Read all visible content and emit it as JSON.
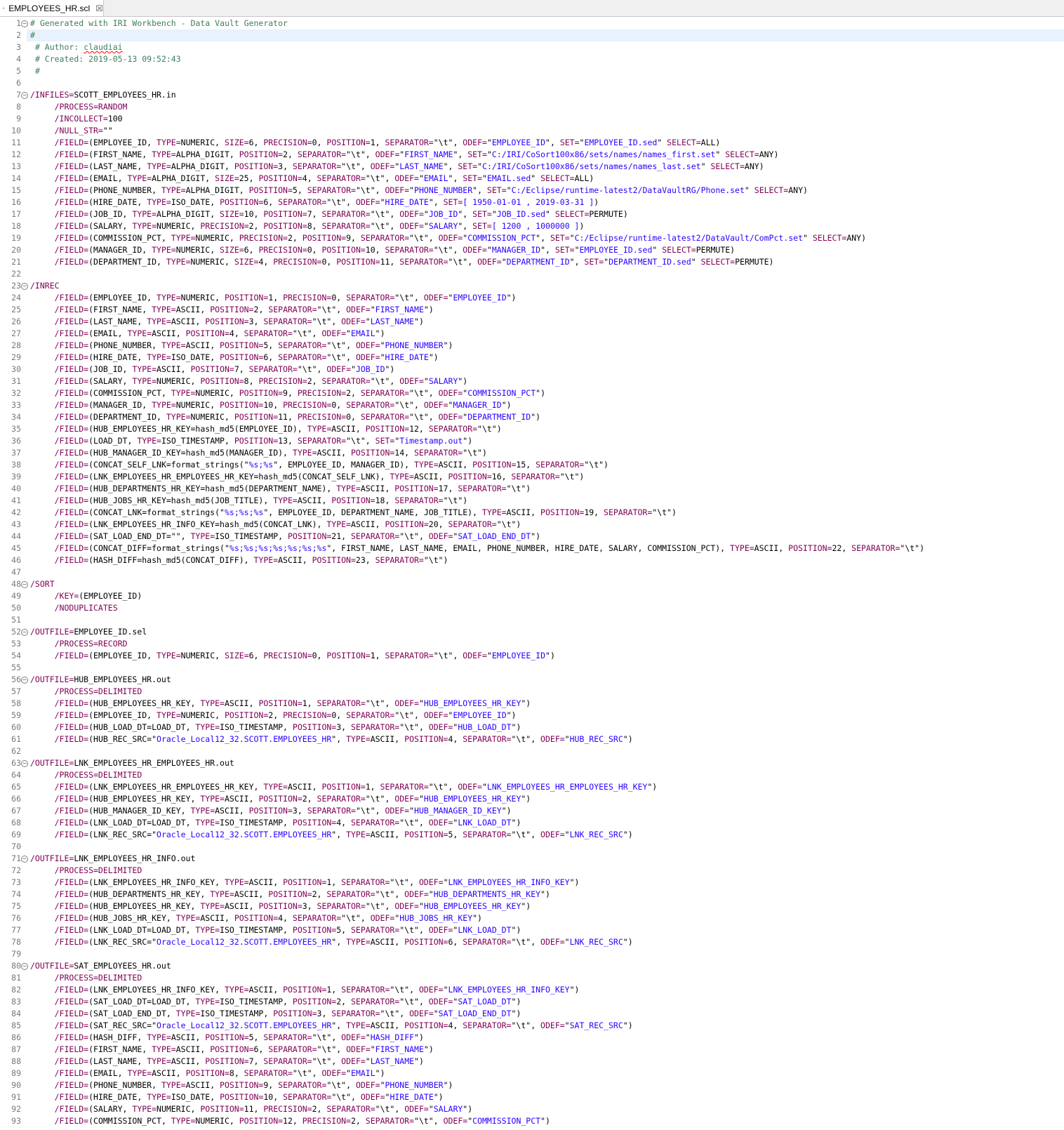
{
  "tab": {
    "file_name": "EMPLOYEES_HR.scl",
    "close_glyph": "☒",
    "icon": "scl-file-icon"
  },
  "colors": {
    "comment": "#3f7f5f",
    "keyword": "#7f0055",
    "string": "#2a00ff",
    "plain": "#000000",
    "line_number": "#787878",
    "current_line": "#e8f2fe"
  },
  "editor": {
    "current_line": 2,
    "lines": [
      {
        "n": "1",
        "f": true,
        "s": "<# Generated with IRI Workbench - Data Vault Generator>"
      },
      {
        "n": "2",
        "s": "<#>"
      },
      {
        "n": "3",
        "s": " <# Author: ><~claudiai>"
      },
      {
        "n": "4",
        "s": " <# Created: 2019-05-13 09:52:43>"
      },
      {
        "n": "5",
        "s": " <#>"
      },
      {
        "n": "6",
        "s": ""
      },
      {
        "n": "7",
        "f": true,
        "s": "[/INFILES=]SCOTT_EMPLOYEES_HR.in"
      },
      {
        "n": "8",
        "s": "     [/PROCESS=RANDOM]"
      },
      {
        "n": "9",
        "s": "     [/INCOLLECT=]100"
      },
      {
        "n": "10",
        "s": "     [/NULL_STR=]\"\""
      },
      {
        "n": "11",
        "s": "     [/FIELD=](EMPLOYEE_ID, [TYPE=]NUMERIC, [SIZE=]6, [PRECISION=]0, [POSITION=]1, [SEPARATOR=]\"\\t\", [ODEF=]\"{EMPLOYEE_ID}\", [SET=]\"{EMPLOYEE_ID.sed}\" [SELECT=]ALL)"
      },
      {
        "n": "12",
        "s": "     [/FIELD=](FIRST_NAME, [TYPE=]ALPHA_DIGIT, [POSITION=]2, [SEPARATOR=]\"\\t\", [ODEF=]\"{FIRST_NAME}\", [SET=]\"{C:/IRI/CoSort100x86/sets/names/names_first.set}\" [SELECT=]ANY)"
      },
      {
        "n": "13",
        "s": "     [/FIELD=](LAST_NAME, [TYPE=]ALPHA_DIGIT, [POSITION=]3, [SEPARATOR=]\"\\t\", [ODEF=]\"{LAST_NAME}\", [SET=]\"{C:/IRI/CoSort100x86/sets/names/names_last.set}\" [SELECT=]ANY)"
      },
      {
        "n": "14",
        "s": "     [/FIELD=](EMAIL, [TYPE=]ALPHA_DIGIT, [SIZE=]25, [POSITION=]4, [SEPARATOR=]\"\\t\", [ODEF=]\"{EMAIL}\", [SET=]\"{EMAIL.sed}\" [SELECT=]ALL)"
      },
      {
        "n": "15",
        "s": "     [/FIELD=](PHONE_NUMBER, [TYPE=]ALPHA_DIGIT, [POSITION=]5, [SEPARATOR=]\"\\t\", [ODEF=]\"{PHONE_NUMBER}\", [SET=]\"{C:/Eclipse/runtime-latest2/DataVaultRG/Phone.set}\" [SELECT=]ANY)"
      },
      {
        "n": "16",
        "s": "     [/FIELD=](HIRE_DATE, [TYPE=]ISO_DATE, [POSITION=]6, [SEPARATOR=]\"\\t\", [ODEF=]\"{HIRE_DATE}\", [SET=]{[ 1950-01-01 , 2019-03-31 ]})"
      },
      {
        "n": "17",
        "s": "     [/FIELD=](JOB_ID, [TYPE=]ALPHA_DIGIT, [SIZE=]10, [POSITION=]7, [SEPARATOR=]\"\\t\", [ODEF=]\"{JOB_ID}\", [SET=]\"{JOB_ID.sed}\" [SELECT=]PERMUTE)"
      },
      {
        "n": "18",
        "s": "     [/FIELD=](SALARY, [TYPE=]NUMERIC, [PRECISION=]2, [POSITION=]8, [SEPARATOR=]\"\\t\", [ODEF=]\"{SALARY}\", [SET=]{[ 1200 , 1000000 ]})"
      },
      {
        "n": "19",
        "s": "     [/FIELD=](COMMISSION_PCT, [TYPE=]NUMERIC, [PRECISION=]2, [POSITION=]9, [SEPARATOR=]\"\\t\", [ODEF=]\"{COMMISSION_PCT}\", [SET=]\"{C:/Eclipse/runtime-latest2/DataVault/ComPct.set}\" [SELECT=]ANY)"
      },
      {
        "n": "20",
        "s": "     [/FIELD=](MANAGER_ID, [TYPE=]NUMERIC, [SIZE=]6, [PRECISION=]0, [POSITION=]10, [SEPARATOR=]\"\\t\", [ODEF=]\"{MANAGER_ID}\", [SET=]\"{EMPLOYEE_ID.sed}\" [SELECT=]PERMUTE)"
      },
      {
        "n": "21",
        "s": "     [/FIELD=](DEPARTMENT_ID, [TYPE=]NUMERIC, [SIZE=]4, [PRECISION=]0, [POSITION=]11, [SEPARATOR=]\"\\t\", [ODEF=]\"{DEPARTMENT_ID}\", [SET=]\"{DEPARTMENT_ID.sed}\" [SELECT=]PERMUTE)"
      },
      {
        "n": "22",
        "s": ""
      },
      {
        "n": "23",
        "f": true,
        "s": "[/INREC]"
      },
      {
        "n": "24",
        "s": "     [/FIELD=](EMPLOYEE_ID, [TYPE=]NUMERIC, [POSITION=]1, [PRECISION=]0, [SEPARATOR=]\"\\t\", [ODEF=]\"{EMPLOYEE_ID}\")"
      },
      {
        "n": "25",
        "s": "     [/FIELD=](FIRST_NAME, [TYPE=]ASCII, [POSITION=]2, [SEPARATOR=]\"\\t\", [ODEF=]\"{FIRST_NAME}\")"
      },
      {
        "n": "26",
        "s": "     [/FIELD=](LAST_NAME, [TYPE=]ASCII, [POSITION=]3, [SEPARATOR=]\"\\t\", [ODEF=]\"{LAST_NAME}\")"
      },
      {
        "n": "27",
        "s": "     [/FIELD=](EMAIL, [TYPE=]ASCII, [POSITION=]4, [SEPARATOR=]\"\\t\", [ODEF=]\"{EMAIL}\")"
      },
      {
        "n": "28",
        "s": "     [/FIELD=](PHONE_NUMBER, [TYPE=]ASCII, [POSITION=]5, [SEPARATOR=]\"\\t\", [ODEF=]\"{PHONE_NUMBER}\")"
      },
      {
        "n": "29",
        "s": "     [/FIELD=](HIRE_DATE, [TYPE=]ISO_DATE, [POSITION=]6, [SEPARATOR=]\"\\t\", [ODEF=]\"{HIRE_DATE}\")"
      },
      {
        "n": "30",
        "s": "     [/FIELD=](JOB_ID, [TYPE=]ASCII, [POSITION=]7, [SEPARATOR=]\"\\t\", [ODEF=]\"{JOB_ID}\")"
      },
      {
        "n": "31",
        "s": "     [/FIELD=](SALARY, [TYPE=]NUMERIC, [POSITION=]8, [PRECISION=]2, [SEPARATOR=]\"\\t\", [ODEF=]\"{SALARY}\")"
      },
      {
        "n": "32",
        "s": "     [/FIELD=](COMMISSION_PCT, [TYPE=]NUMERIC, [POSITION=]9, [PRECISION=]2, [SEPARATOR=]\"\\t\", [ODEF=]\"{COMMISSION_PCT}\")"
      },
      {
        "n": "33",
        "s": "     [/FIELD=](MANAGER_ID, [TYPE=]NUMERIC, [POSITION=]10, [PRECISION=]0, [SEPARATOR=]\"\\t\", [ODEF=]\"{MANAGER_ID}\")"
      },
      {
        "n": "34",
        "s": "     [/FIELD=](DEPARTMENT_ID, [TYPE=]NUMERIC, [POSITION=]11, [PRECISION=]0, [SEPARATOR=]\"\\t\", [ODEF=]\"{DEPARTMENT_ID}\")"
      },
      {
        "n": "35",
        "s": "     [/FIELD=](HUB_EMPLOYEES_HR_KEY=hash_md5(EMPLOYEE_ID), [TYPE=]ASCII, [POSITION=]12, [SEPARATOR=]\"\\t\")"
      },
      {
        "n": "36",
        "s": "     [/FIELD=](LOAD_DT, [TYPE=]ISO_TIMESTAMP, [POSITION=]13, [SEPARATOR=]\"\\t\", [SET=]\"{Timestamp.out}\")"
      },
      {
        "n": "37",
        "s": "     [/FIELD=](HUB_MANAGER_ID_KEY=hash_md5(MANAGER_ID), [TYPE=]ASCII, [POSITION=]14, [SEPARATOR=]\"\\t\")"
      },
      {
        "n": "38",
        "s": "     [/FIELD=](CONCAT_SELF_LNK=format_strings(\"{%s;%s}\", EMPLOYEE_ID, MANAGER_ID), [TYPE=]ASCII, [POSITION=]15, [SEPARATOR=]\"\\t\")"
      },
      {
        "n": "39",
        "s": "     [/FIELD=](LNK_EMPLOYEES_HR_EMPLOYEES_HR_KEY=hash_md5(CONCAT_SELF_LNK), [TYPE=]ASCII, [POSITION=]16, [SEPARATOR=]\"\\t\")"
      },
      {
        "n": "40",
        "s": "     [/FIELD=](HUB_DEPARTMENTS_HR_KEY=hash_md5(DEPARTMENT_NAME), [TYPE=]ASCII, [POSITION=]17, [SEPARATOR=]\"\\t\")"
      },
      {
        "n": "41",
        "s": "     [/FIELD=](HUB_JOBS_HR_KEY=hash_md5(JOB_TITLE), [TYPE=]ASCII, [POSITION=]18, [SEPARATOR=]\"\\t\")"
      },
      {
        "n": "42",
        "s": "     [/FIELD=](CONCAT_LNK=format_strings(\"{%s;%s;%s}\", EMPLOYEE_ID, DEPARTMENT_NAME, JOB_TITLE), [TYPE=]ASCII, [POSITION=]19, [SEPARATOR=]\"\\t\")"
      },
      {
        "n": "43",
        "s": "     [/FIELD=](LNK_EMPLOYEES_HR_INFO_KEY=hash_md5(CONCAT_LNK), [TYPE=]ASCII, [POSITION=]20, [SEPARATOR=]\"\\t\")"
      },
      {
        "n": "44",
        "s": "     [/FIELD=](SAT_LOAD_END_DT=\"\", [TYPE=]ISO_TIMESTAMP, [POSITION=]21, [SEPARATOR=]\"\\t\", [ODEF=]\"{SAT_LOAD_END_DT}\")"
      },
      {
        "n": "45",
        "s": "     [/FIELD=](CONCAT_DIFF=format_strings(\"{%s;%s;%s;%s;%s;%s;%s}\", FIRST_NAME, LAST_NAME, EMAIL, PHONE_NUMBER, HIRE_DATE, SALARY, COMMISSION_PCT), [TYPE=]ASCII, [POSITION=]22, [SEPARATOR=]\"\\t\")"
      },
      {
        "n": "46",
        "s": "     [/FIELD=](HASH_DIFF=hash_md5(CONCAT_DIFF), [TYPE=]ASCII, [POSITION=]23, [SEPARATOR=]\"\\t\")"
      },
      {
        "n": "47",
        "s": ""
      },
      {
        "n": "48",
        "f": true,
        "s": "[/SORT]"
      },
      {
        "n": "49",
        "s": "     [/KEY=](EMPLOYEE_ID)"
      },
      {
        "n": "50",
        "s": "     [/NODUPLICATES]"
      },
      {
        "n": "51",
        "s": ""
      },
      {
        "n": "52",
        "f": true,
        "s": "[/OUTFILE=]EMPLOYEE_ID.sel"
      },
      {
        "n": "53",
        "s": "     [/PROCESS=RECORD]"
      },
      {
        "n": "54",
        "s": "     [/FIELD=](EMPLOYEE_ID, [TYPE=]NUMERIC, [SIZE=]6, [PRECISION=]0, [POSITION=]1, [SEPARATOR=]\"\\t\", [ODEF=]\"{EMPLOYEE_ID}\")"
      },
      {
        "n": "55",
        "s": ""
      },
      {
        "n": "56",
        "f": true,
        "s": "[/OUTFILE=]HUB_EMPLOYEES_HR.out"
      },
      {
        "n": "57",
        "s": "     [/PROCESS=DELIMITED]"
      },
      {
        "n": "58",
        "s": "     [/FIELD=](HUB_EMPLOYEES_HR_KEY, [TYPE=]ASCII, [POSITION=]1, [SEPARATOR=]\"\\t\", [ODEF=]\"{HUB_EMPLOYEES_HR_KEY}\")"
      },
      {
        "n": "59",
        "s": "     [/FIELD=](EMPLOYEE_ID, [TYPE=]NUMERIC, [POSITION=]2, [PRECISION=]0, [SEPARATOR=]\"\\t\", [ODEF=]\"{EMPLOYEE_ID}\")"
      },
      {
        "n": "60",
        "s": "     [/FIELD=](HUB_LOAD_DT=LOAD_DT, [TYPE=]ISO_TIMESTAMP, [POSITION=]3, [SEPARATOR=]\"\\t\", [ODEF=]\"{HUB_LOAD_DT}\")"
      },
      {
        "n": "61",
        "s": "     [/FIELD=](HUB_REC_SRC=\"{Oracle_Local12_32.SCOTT.EMPLOYEES_HR}\", [TYPE=]ASCII, [POSITION=]4, [SEPARATOR=]\"\\t\", [ODEF=]\"{HUB_REC_SRC}\")"
      },
      {
        "n": "62",
        "s": ""
      },
      {
        "n": "63",
        "f": true,
        "s": "[/OUTFILE=]LNK_EMPLOYEES_HR_EMPLOYEES_HR.out"
      },
      {
        "n": "64",
        "s": "     [/PROCESS=DELIMITED]"
      },
      {
        "n": "65",
        "s": "     [/FIELD=](LNK_EMPLOYEES_HR_EMPLOYEES_HR_KEY, [TYPE=]ASCII, [POSITION=]1, [SEPARATOR=]\"\\t\", [ODEF=]\"{LNK_EMPLOYEES_HR_EMPLOYEES_HR_KEY}\")"
      },
      {
        "n": "66",
        "s": "     [/FIELD=](HUB_EMPLOYEES_HR_KEY, [TYPE=]ASCII, [POSITION=]2, [SEPARATOR=]\"\\t\", [ODEF=]\"{HUB_EMPLOYEES_HR_KEY}\")"
      },
      {
        "n": "67",
        "s": "     [/FIELD=](HUB_MANAGER_ID_KEY, [TYPE=]ASCII, [POSITION=]3, [SEPARATOR=]\"\\t\", [ODEF=]\"{HUB_MANAGER_ID_KEY}\")"
      },
      {
        "n": "68",
        "s": "     [/FIELD=](LNK_LOAD_DT=LOAD_DT, [TYPE=]ISO_TIMESTAMP, [POSITION=]4, [SEPARATOR=]\"\\t\", [ODEF=]\"{LNK_LOAD_DT}\")"
      },
      {
        "n": "69",
        "s": "     [/FIELD=](LNK_REC_SRC=\"{Oracle_Local12_32.SCOTT.EMPLOYEES_HR}\", [TYPE=]ASCII, [POSITION=]5, [SEPARATOR=]\"\\t\", [ODEF=]\"{LNK_REC_SRC}\")"
      },
      {
        "n": "70",
        "s": ""
      },
      {
        "n": "71",
        "f": true,
        "s": "[/OUTFILE=]LNK_EMPLOYEES_HR_INFO.out"
      },
      {
        "n": "72",
        "s": "     [/PROCESS=DELIMITED]"
      },
      {
        "n": "73",
        "s": "     [/FIELD=](LNK_EMPLOYEES_HR_INFO_KEY, [TYPE=]ASCII, [POSITION=]1, [SEPARATOR=]\"\\t\", [ODEF=]\"{LNK_EMPLOYEES_HR_INFO_KEY}\")"
      },
      {
        "n": "74",
        "s": "     [/FIELD=](HUB_DEPARTMENTS_HR_KEY, [TYPE=]ASCII, [POSITION=]2, [SEPARATOR=]\"\\t\", [ODEF=]\"{HUB_DEPARTMENTS_HR_KEY}\")"
      },
      {
        "n": "75",
        "s": "     [/FIELD=](HUB_EMPLOYEES_HR_KEY, [TYPE=]ASCII, [POSITION=]3, [SEPARATOR=]\"\\t\", [ODEF=]\"{HUB_EMPLOYEES_HR_KEY}\")"
      },
      {
        "n": "76",
        "s": "     [/FIELD=](HUB_JOBS_HR_KEY, [TYPE=]ASCII, [POSITION=]4, [SEPARATOR=]\"\\t\", [ODEF=]\"{HUB_JOBS_HR_KEY}\")"
      },
      {
        "n": "77",
        "s": "     [/FIELD=](LNK_LOAD_DT=LOAD_DT, [TYPE=]ISO_TIMESTAMP, [POSITION=]5, [SEPARATOR=]\"\\t\", [ODEF=]\"{LNK_LOAD_DT}\")"
      },
      {
        "n": "78",
        "s": "     [/FIELD=](LNK_REC_SRC=\"{Oracle_Local12_32.SCOTT.EMPLOYEES_HR}\", [TYPE=]ASCII, [POSITION=]6, [SEPARATOR=]\"\\t\", [ODEF=]\"{LNK_REC_SRC}\")"
      },
      {
        "n": "79",
        "s": ""
      },
      {
        "n": "80",
        "f": true,
        "s": "[/OUTFILE=]SAT_EMPLOYEES_HR.out"
      },
      {
        "n": "81",
        "s": "     [/PROCESS=DELIMITED]"
      },
      {
        "n": "82",
        "s": "     [/FIELD=](LNK_EMPLOYEES_HR_INFO_KEY, [TYPE=]ASCII, [POSITION=]1, [SEPARATOR=]\"\\t\", [ODEF=]\"{LNK_EMPLOYEES_HR_INFO_KEY}\")"
      },
      {
        "n": "83",
        "s": "     [/FIELD=](SAT_LOAD_DT=LOAD_DT, [TYPE=]ISO_TIMESTAMP, [POSITION=]2, [SEPARATOR=]\"\\t\", [ODEF=]\"{SAT_LOAD_DT}\")"
      },
      {
        "n": "84",
        "s": "     [/FIELD=](SAT_LOAD_END_DT, [TYPE=]ISO_TIMESTAMP, [POSITION=]3, [SEPARATOR=]\"\\t\", [ODEF=]\"{SAT_LOAD_END_DT}\")"
      },
      {
        "n": "85",
        "s": "     [/FIELD=](SAT_REC_SRC=\"{Oracle_Local12_32.SCOTT.EMPLOYEES_HR}\", [TYPE=]ASCII, [POSITION=]4, [SEPARATOR=]\"\\t\", [ODEF=]\"{SAT_REC_SRC}\")"
      },
      {
        "n": "86",
        "s": "     [/FIELD=](HASH_DIFF, [TYPE=]ASCII, [POSITION=]5, [SEPARATOR=]\"\\t\", [ODEF=]\"{HASH_DIFF}\")"
      },
      {
        "n": "87",
        "s": "     [/FIELD=](FIRST_NAME, [TYPE=]ASCII, [POSITION=]6, [SEPARATOR=]\"\\t\", [ODEF=]\"{FIRST_NAME}\")"
      },
      {
        "n": "88",
        "s": "     [/FIELD=](LAST_NAME, [TYPE=]ASCII, [POSITION=]7, [SEPARATOR=]\"\\t\", [ODEF=]\"{LAST_NAME}\")"
      },
      {
        "n": "89",
        "s": "     [/FIELD=](EMAIL, [TYPE=]ASCII, [POSITION=]8, [SEPARATOR=]\"\\t\", [ODEF=]\"{EMAIL}\")"
      },
      {
        "n": "90",
        "s": "     [/FIELD=](PHONE_NUMBER, [TYPE=]ASCII, [POSITION=]9, [SEPARATOR=]\"\\t\", [ODEF=]\"{PHONE_NUMBER}\")"
      },
      {
        "n": "91",
        "s": "     [/FIELD=](HIRE_DATE, [TYPE=]ISO_DATE, [POSITION=]10, [SEPARATOR=]\"\\t\", [ODEF=]\"{HIRE_DATE}\")"
      },
      {
        "n": "92",
        "s": "     [/FIELD=](SALARY, [TYPE=]NUMERIC, [POSITION=]11, [PRECISION=]2, [SEPARATOR=]\"\\t\", [ODEF=]\"{SALARY}\")"
      },
      {
        "n": "93",
        "s": "     [/FIELD=](COMMISSION_PCT, [TYPE=]NUMERIC, [POSITION=]12, [PRECISION=]2, [SEPARATOR=]\"\\t\", [ODEF=]\"{COMMISSION_PCT}\")"
      }
    ]
  }
}
